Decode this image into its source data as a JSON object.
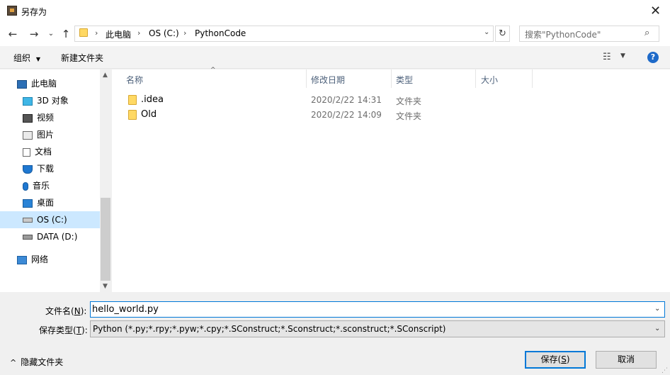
{
  "window": {
    "title": "另存为",
    "close_glyph": "✕"
  },
  "nav": {
    "back_glyph": "←",
    "forward_glyph": "→",
    "recent_glyph": "⌄",
    "up_glyph": "↑",
    "breadcrumb": [
      "此电脑",
      "OS (C:)",
      "PythonCode"
    ],
    "breadcrumb_sep": "›",
    "dropdown_glyph": "⌄",
    "refresh_glyph": "↻",
    "search_placeholder": "搜索\"PythonCode\"",
    "search_glyph": "⌕"
  },
  "toolbar": {
    "organize_label": "组织",
    "organize_caret": "▼",
    "new_folder_label": "新建文件夹",
    "view_glyph": "☷",
    "view_caret": "▼",
    "help_glyph": "?"
  },
  "sidebar": {
    "items": [
      {
        "label": "此电脑",
        "icon": "pc-icon"
      },
      {
        "label": "3D 对象",
        "icon": "3d-objects-icon"
      },
      {
        "label": "视频",
        "icon": "video-icon"
      },
      {
        "label": "图片",
        "icon": "pictures-icon"
      },
      {
        "label": "文档",
        "icon": "documents-icon"
      },
      {
        "label": "下载",
        "icon": "downloads-icon"
      },
      {
        "label": "音乐",
        "icon": "music-icon"
      },
      {
        "label": "桌面",
        "icon": "desktop-icon"
      },
      {
        "label": "OS (C:)",
        "icon": "drive-c-icon",
        "selected": true
      },
      {
        "label": "DATA (D:)",
        "icon": "drive-d-icon"
      },
      {
        "label": "网络",
        "icon": "network-icon"
      }
    ],
    "scroll_up": "▲",
    "scroll_down": "▼"
  },
  "files": {
    "columns": {
      "name": "名称",
      "modified": "修改日期",
      "type": "类型",
      "size": "大小"
    },
    "sort_caret": "^",
    "rows": [
      {
        "name": ".idea",
        "modified": "2020/2/22 14:31",
        "type": "文件夹",
        "size": ""
      },
      {
        "name": "Old",
        "modified": "2020/2/22 14:09",
        "type": "文件夹",
        "size": ""
      }
    ]
  },
  "form": {
    "filename_label": "文件名",
    "filename_key": "N",
    "filename_value": "hello_world.py",
    "filetype_label": "保存类型",
    "filetype_key": "T",
    "filetype_value": "Python (*.py;*.rpy;*.pyw;*.cpy;*.SConstruct;*.Sconstruct;*.sconstruct;*.SConscript)",
    "dropdown_glyph": "⌄"
  },
  "footer": {
    "hide_folders_caret": "^",
    "hide_folders_label": "隐藏文件夹",
    "save_label": "保存",
    "save_key": "S",
    "cancel_label": "取消"
  },
  "colors": {
    "accent": "#0078d7",
    "selection": "#cce8ff",
    "folder": "#ffd964",
    "header_text": "#4c607a",
    "help": "#1e6ac9"
  }
}
